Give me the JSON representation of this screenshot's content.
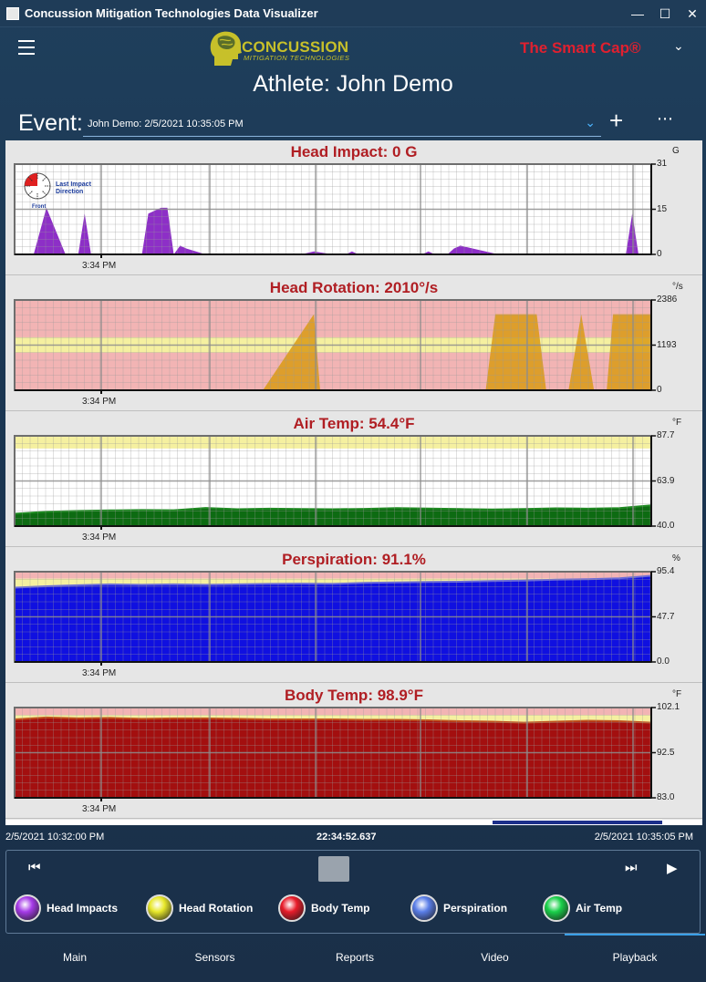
{
  "window": {
    "title": "Concussion Mitigation Technologies Data Visualizer"
  },
  "header": {
    "brand": "CONCUSSION",
    "brand_tagline": "MITIGATION TECHNOLOGIES",
    "product": "The Smart Cap®"
  },
  "athlete": "Athlete: John Demo",
  "event": {
    "label": "Event:",
    "selected": "John Demo: 2/5/2021 10:35:05 PM"
  },
  "colors": {
    "head_impact_fill": "#8d2fc7",
    "head_rotation_fill": "#d99a14",
    "air_temp_fill": "#0d6b12",
    "perspiration_fill": "#1010e0",
    "body_temp_fill": "#a30f0f",
    "danger_band": "#f2b4b4",
    "warn_band": "#f5f0a0",
    "title_red": "#b01e23",
    "accent_blue": "#3aa0e8"
  },
  "direction_indicator": {
    "label": "Last Impact Direction",
    "front_label": "Front"
  },
  "charts": [
    {
      "id": "head-impact",
      "title": "Head Impact: 0 G",
      "unit": "G",
      "ticks": [
        "31",
        "15",
        "0"
      ],
      "time_label": "3:34 PM"
    },
    {
      "id": "head-rotation",
      "title": "Head Rotation: 2010°/s",
      "unit": "°/s",
      "ticks": [
        "2386",
        "1193",
        "0"
      ],
      "time_label": "3:34 PM"
    },
    {
      "id": "air-temp",
      "title": "Air Temp: 54.4°F",
      "unit": "°F",
      "ticks": [
        "87.7",
        "63.9",
        "40.0"
      ],
      "time_label": "3:34 PM"
    },
    {
      "id": "perspiration",
      "title": "Perspiration: 91.1%",
      "unit": "%",
      "ticks": [
        "95.4",
        "47.7",
        "0.0"
      ],
      "time_label": "3:34 PM"
    },
    {
      "id": "body-temp",
      "title": "Body Temp: 98.9°F",
      "unit": "°F",
      "ticks": [
        "102.1",
        "92.5",
        "83.0"
      ],
      "time_label": "3:34 PM"
    }
  ],
  "chart_data": [
    {
      "type": "area",
      "title": "Head Impact: 0 G",
      "ylim": [
        0,
        31
      ],
      "x": [
        0,
        0.03,
        0.05,
        0.08,
        0.09,
        0.1,
        0.11,
        0.12,
        0.13,
        0.2,
        0.21,
        0.23,
        0.24,
        0.25,
        0.26,
        0.27,
        0.3,
        0.32,
        0.35,
        0.45,
        0.47,
        0.5,
        0.52,
        0.53,
        0.54,
        0.64,
        0.65,
        0.66,
        0.67,
        0.68,
        0.69,
        0.7,
        0.72,
        0.76,
        0.77,
        0.96,
        0.97,
        0.98,
        1.0
      ],
      "values": [
        0,
        0,
        16,
        0,
        0,
        0,
        14,
        0,
        0,
        0,
        14,
        16,
        16,
        0,
        3,
        2,
        0,
        0,
        0,
        0,
        1,
        0,
        0,
        1,
        0,
        0,
        1,
        0,
        0,
        0,
        2,
        3,
        2,
        0,
        0,
        0,
        14,
        0,
        0
      ]
    },
    {
      "type": "area",
      "title": "Head Rotation: 2010°/s",
      "ylim": [
        0,
        2386
      ],
      "thresholds": {
        "warn_low": 1000,
        "warn_high": 1400
      },
      "x": [
        0,
        0.39,
        0.47,
        0.48,
        0.74,
        0.755,
        0.82,
        0.835,
        0.87,
        0.89,
        0.91,
        0.93,
        0.94,
        0.97,
        1.0
      ],
      "values": [
        0,
        0,
        2010,
        0,
        0,
        2010,
        2010,
        0,
        0,
        2010,
        0,
        0,
        2010,
        2010,
        2010
      ]
    },
    {
      "type": "area",
      "title": "Air Temp: 54.4°F",
      "ylim": [
        40.0,
        87.7
      ],
      "warn_band": [
        81.0,
        87.7
      ],
      "x": [
        0,
        0.05,
        0.1,
        0.15,
        0.2,
        0.25,
        0.3,
        0.35,
        0.4,
        0.45,
        0.5,
        0.55,
        0.6,
        0.65,
        0.7,
        0.75,
        0.8,
        0.85,
        0.9,
        0.95,
        1.0
      ],
      "values": [
        46.5,
        47.6,
        48.0,
        48.3,
        48.5,
        48.4,
        49.6,
        48.9,
        49.2,
        49.0,
        48.9,
        49.1,
        49.5,
        49.3,
        49.0,
        48.8,
        49.0,
        49.4,
        49.2,
        49.5,
        51.0
      ]
    },
    {
      "type": "area",
      "title": "Perspiration: 91.1%",
      "ylim": [
        0.0,
        95.4
      ],
      "danger_band": [
        88.0,
        95.4
      ],
      "warn_band": [
        80.0,
        88.0
      ],
      "x": [
        0,
        0.05,
        0.1,
        0.15,
        0.2,
        0.25,
        0.3,
        0.35,
        0.4,
        0.45,
        0.5,
        0.55,
        0.6,
        0.65,
        0.7,
        0.75,
        0.8,
        0.85,
        0.9,
        0.95,
        1.0
      ],
      "values": [
        78.5,
        80.0,
        81.0,
        82.0,
        81.5,
        82.0,
        81.5,
        82.0,
        82.5,
        82.8,
        82.5,
        83.5,
        84.0,
        84.5,
        84.8,
        85.5,
        86.0,
        87.0,
        87.5,
        88.5,
        91.1
      ]
    },
    {
      "type": "area",
      "title": "Body Temp: 98.9°F",
      "ylim": [
        83.0,
        102.1
      ],
      "danger_band": [
        100.5,
        102.1
      ],
      "warn_band": [
        99.0,
        100.5
      ],
      "x": [
        0,
        0.05,
        0.1,
        0.15,
        0.2,
        0.25,
        0.3,
        0.35,
        0.4,
        0.45,
        0.5,
        0.55,
        0.6,
        0.65,
        0.7,
        0.75,
        0.8,
        0.85,
        0.9,
        0.95,
        1.0
      ],
      "values": [
        99.6,
        100.0,
        99.8,
        99.9,
        99.7,
        99.8,
        99.8,
        99.7,
        99.6,
        99.6,
        99.6,
        99.5,
        99.5,
        99.4,
        99.2,
        99.1,
        98.9,
        99.1,
        99.3,
        99.2,
        98.9
      ]
    }
  ],
  "timeline": {
    "start": "2/5/2021 10:32:00 PM",
    "current": "22:34:52.637",
    "end": "2/5/2021 10:35:05 PM"
  },
  "legend": [
    {
      "label": "Head Impacts",
      "color": "#a63be8"
    },
    {
      "label": "Head Rotation",
      "color": "#e8e82a"
    },
    {
      "label": "Body Temp",
      "color": "#e81c2a"
    },
    {
      "label": "Perspiration",
      "color": "#5a7ee8"
    },
    {
      "label": "Air Temp",
      "color": "#1ad04a"
    }
  ],
  "tabs": [
    "Main",
    "Sensors",
    "Reports",
    "Video",
    "Playback"
  ],
  "active_tab": "Playback"
}
